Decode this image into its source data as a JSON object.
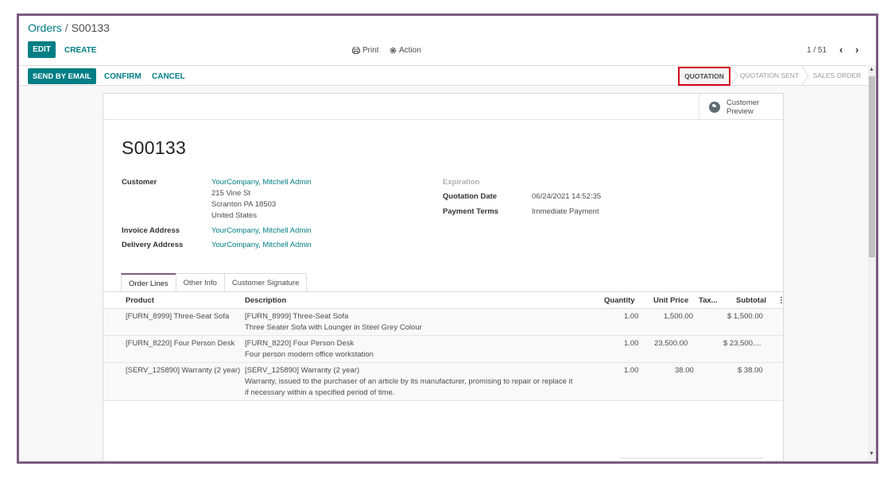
{
  "breadcrumb": {
    "parent": "Orders",
    "separator": "/",
    "current": "S00133"
  },
  "buttons": {
    "edit": "EDIT",
    "create": "CREATE",
    "print": "Print",
    "action": "Action",
    "send_by_email": "SEND BY EMAIL",
    "confirm": "CONFIRM",
    "cancel": "CANCEL",
    "customer_preview": "Customer Preview"
  },
  "pager": {
    "value": "1 / 51",
    "prev": "‹",
    "next": "›"
  },
  "statusbar": {
    "stages": [
      "QUOTATION",
      "QUOTATION SENT",
      "SALES ORDER"
    ],
    "active": "QUOTATION"
  },
  "order": {
    "name": "S00133",
    "customer_label": "Customer",
    "customer": "YourCompany, Mitchell Admin",
    "address_line1": "215 Vine St",
    "address_line2": "Scranton PA 18503",
    "address_line3": "United States",
    "invoice_label": "Invoice Address",
    "invoice": "YourCompany, Mitchell Admin",
    "delivery_label": "Delivery Address",
    "delivery": "YourCompany, Mitchell Admin",
    "expiration_label": "Expiration",
    "quotation_date_label": "Quotation Date",
    "quotation_date": "06/24/2021 14:52:35",
    "payment_terms_label": "Payment Terms",
    "payment_terms": "Immediate Payment"
  },
  "tabs": [
    "Order Lines",
    "Other Info",
    "Customer Signature"
  ],
  "columns": {
    "product": "Product",
    "description": "Description",
    "quantity": "Quantity",
    "unit_price": "Unit Price",
    "taxes": "Tax...",
    "subtotal": "Subtotal"
  },
  "lines": [
    {
      "product": "[FURN_8999] Three-Seat Sofa",
      "desc1": "[FURN_8999] Three-Seat Sofa",
      "desc2": "Three Seater Sofa with Lounger in Steel Grey Colour",
      "desc3": "",
      "qty": "1.00",
      "price": "1,500.00",
      "subtotal": "$ 1,500.00"
    },
    {
      "product": "[FURN_8220] Four Person Desk",
      "desc1": "[FURN_8220] Four Person Desk",
      "desc2": "Four person modern office workstation",
      "desc3": "",
      "qty": "1.00",
      "price": "23,500.00",
      "subtotal": "$ 23,500...."
    },
    {
      "product": "[SERV_125890] Warranty (2 year)",
      "desc1": "[SERV_125890] Warranty (2 year)",
      "desc2": "Warranty, issued to the purchaser of an article by its manufacturer, promising to repair or replace it",
      "desc3": "if necessary within a specified period of time.",
      "qty": "1.00",
      "price": "38.00",
      "subtotal": "$ 38.00"
    }
  ],
  "colors": {
    "accent": "#017e84",
    "frame": "#7c5b82",
    "highlight": "#d0021b"
  }
}
